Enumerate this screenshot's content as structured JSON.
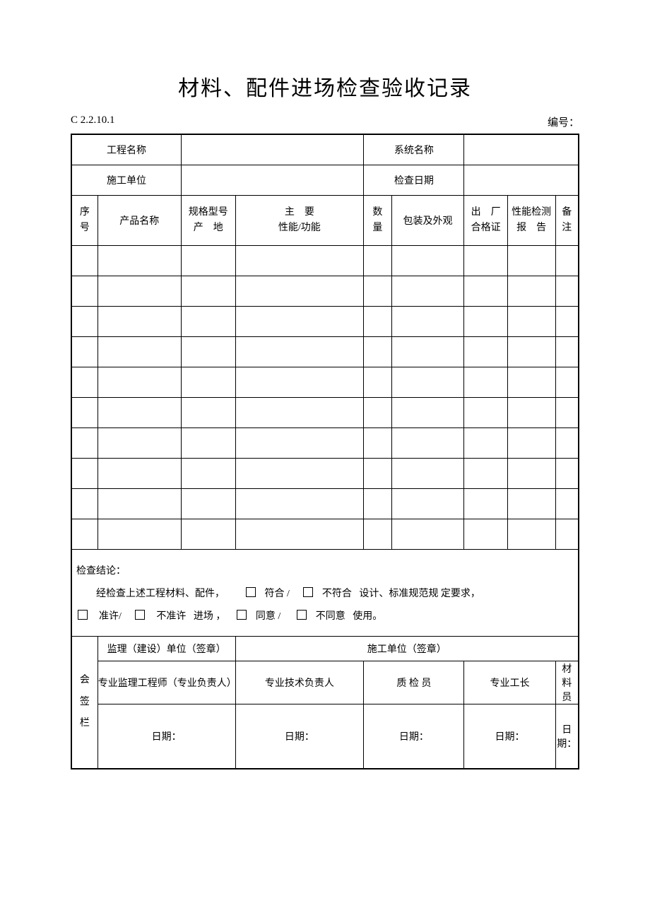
{
  "title": "材料、配件进场检查验收记录",
  "code": "C 2.2.10.1",
  "number_label": "编号：",
  "fields": {
    "project_label": "工程名称",
    "project_value": "",
    "system_label": "系统名称",
    "system_value": "",
    "contractor_label": "施工单位",
    "contractor_value": "",
    "date_label": "检查日期",
    "date_value": ""
  },
  "columns": {
    "seq": "序\n号",
    "name": "产品名称",
    "spec_l1": "规格型号",
    "spec_l2": "产　地",
    "func_l1": "主　要",
    "func_l2": "性能/功能",
    "qty": "数\n量",
    "pack": "包装及外观",
    "cert_l1": "出　厂",
    "cert_l2": "合格证",
    "rept_l1": "性能检测",
    "rept_l2": "报　告",
    "note": "备\n注"
  },
  "rows": [
    {
      "seq": "",
      "name": "",
      "spec": "",
      "func": "",
      "qty": "",
      "pack": "",
      "cert": "",
      "rept": "",
      "note": ""
    },
    {
      "seq": "",
      "name": "",
      "spec": "",
      "func": "",
      "qty": "",
      "pack": "",
      "cert": "",
      "rept": "",
      "note": ""
    },
    {
      "seq": "",
      "name": "",
      "spec": "",
      "func": "",
      "qty": "",
      "pack": "",
      "cert": "",
      "rept": "",
      "note": ""
    },
    {
      "seq": "",
      "name": "",
      "spec": "",
      "func": "",
      "qty": "",
      "pack": "",
      "cert": "",
      "rept": "",
      "note": ""
    },
    {
      "seq": "",
      "name": "",
      "spec": "",
      "func": "",
      "qty": "",
      "pack": "",
      "cert": "",
      "rept": "",
      "note": ""
    },
    {
      "seq": "",
      "name": "",
      "spec": "",
      "func": "",
      "qty": "",
      "pack": "",
      "cert": "",
      "rept": "",
      "note": ""
    },
    {
      "seq": "",
      "name": "",
      "spec": "",
      "func": "",
      "qty": "",
      "pack": "",
      "cert": "",
      "rept": "",
      "note": ""
    },
    {
      "seq": "",
      "name": "",
      "spec": "",
      "func": "",
      "qty": "",
      "pack": "",
      "cert": "",
      "rept": "",
      "note": ""
    },
    {
      "seq": "",
      "name": "",
      "spec": "",
      "func": "",
      "qty": "",
      "pack": "",
      "cert": "",
      "rept": "",
      "note": ""
    },
    {
      "seq": "",
      "name": "",
      "spec": "",
      "func": "",
      "qty": "",
      "pack": "",
      "cert": "",
      "rept": "",
      "note": ""
    }
  ],
  "conclusion": {
    "label": "检查结论：",
    "line1_a": "经检查上述工程材料、配件，",
    "opt_conform": "符合",
    "opt_notconform": "不符合",
    "line1_b": "设计、标准规范规 定要求，",
    "opt_permit": "准许",
    "opt_notpermit": "不准许",
    "word_enter": "进场 ，",
    "opt_agree": "同意",
    "opt_disagree": "不同意",
    "word_use": "使用。",
    "slash": " /"
  },
  "sign": {
    "side": "会\n签\n栏",
    "sup_header": "监理（建设）单位（签章）",
    "con_header": "施工单位（签章）",
    "role_sup": "专业监理工程师（专业负责人）",
    "role_tech": "专业技术负责人",
    "role_qc": "质 检 员",
    "role_foreman": "专业工长",
    "role_material": "材 料 员",
    "date_label": "日期："
  }
}
